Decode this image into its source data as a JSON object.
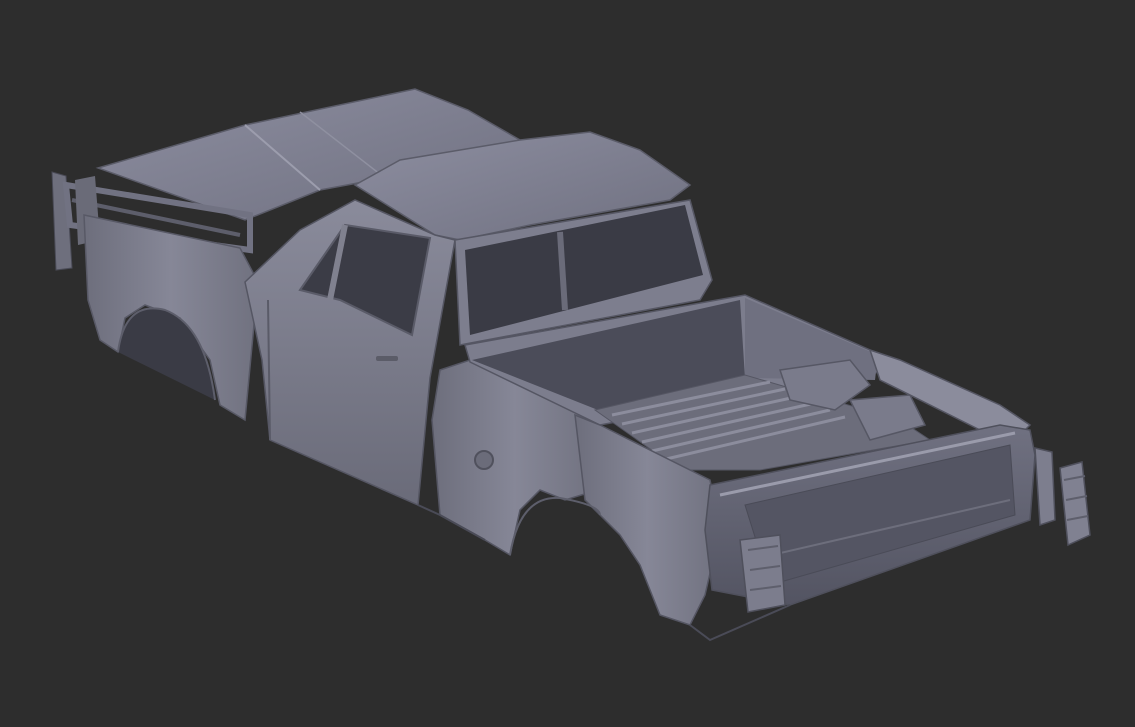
{
  "viewport": {
    "background_color": "#2d2d2d",
    "model_color": "#7b7c8c",
    "model_highlight": "#9a9bab",
    "model_shadow": "#4e4f5c",
    "model_dark": "#3d3e48",
    "subject": "pickup-truck-body-3d-model",
    "shading": "solid-matcap"
  }
}
